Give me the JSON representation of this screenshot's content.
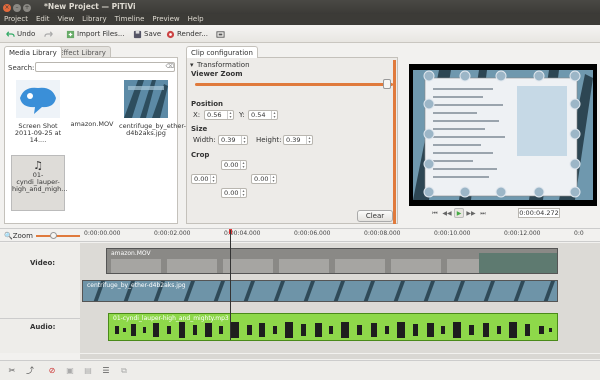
{
  "window": {
    "title": "*New Project — PiTiVi"
  },
  "menu": [
    "Project",
    "Edit",
    "View",
    "Library",
    "Timeline",
    "Preview",
    "Help"
  ],
  "toolbar": {
    "undo_label": "Undo",
    "redo_icon": "redo-icon",
    "import_label": "Import Files...",
    "save_label": "Save",
    "render_label": "Render...",
    "fullscreen_icon": "fullscreen-icon"
  },
  "media_library": {
    "tab_label": "Media Library",
    "effect_tab_label": "Effect Library",
    "search_label": "Search:",
    "search_value": "",
    "clear_icon": "clear-icon",
    "clips": [
      {
        "name": "Screen Shot 2011-09-25 at 14...."
      },
      {
        "name": "amazon.MOV"
      },
      {
        "name": "centrifuge_by_ether-d4b2aks.jpg"
      },
      {
        "name": "01-cyndi_lauper-high_and_migh..."
      }
    ]
  },
  "clip_config": {
    "tab_label": "Clip configuration",
    "section_label": "Transformation",
    "viewer_zoom_label": "Viewer Zoom",
    "position_label": "Position",
    "x_label": "X:",
    "x_value": "0.56",
    "y_label": "Y:",
    "y_value": "0.54",
    "size_label": "Size",
    "width_label": "Width:",
    "width_value": "0.39",
    "height_label": "Height:",
    "height_value": "0.39",
    "crop_label": "Crop",
    "crop_top": "0.00",
    "crop_left": "0.00",
    "crop_right": "0.00",
    "crop_bottom": "0.00",
    "clear_label": "Clear"
  },
  "viewer": {
    "timecode": "0:00:04.272",
    "controls": [
      "skip-backward-icon",
      "rewind-icon",
      "play-icon",
      "forward-icon",
      "skip-forward-icon"
    ]
  },
  "timeline": {
    "zoom_label": "Zoom",
    "ruler": [
      "0:00:00.000",
      "0:00:02.000",
      "0:00:04.000",
      "0:00:06.000",
      "0:00:08.000",
      "0:00:10.000",
      "0:00:12.000",
      "0:0"
    ],
    "video_track_label": "Video:",
    "audio_track_label": "Audio:",
    "video_clip_1": "amazon.MOV",
    "video_clip_2": "centrifuge_by_ether-d4b2aks.jpg",
    "audio_clip": "01-cyndi_lauper-high_and_mighty.mp3"
  },
  "bottom_toolbar": [
    "split-icon",
    "keyframe-icon",
    "delete-icon",
    "group-icon",
    "ungroup-icon",
    "align-icon",
    "link-icon"
  ],
  "colors": {
    "accent": "#e07a3c",
    "audio_clip": "#8ed84a",
    "titlebar": "#3c3b37"
  }
}
